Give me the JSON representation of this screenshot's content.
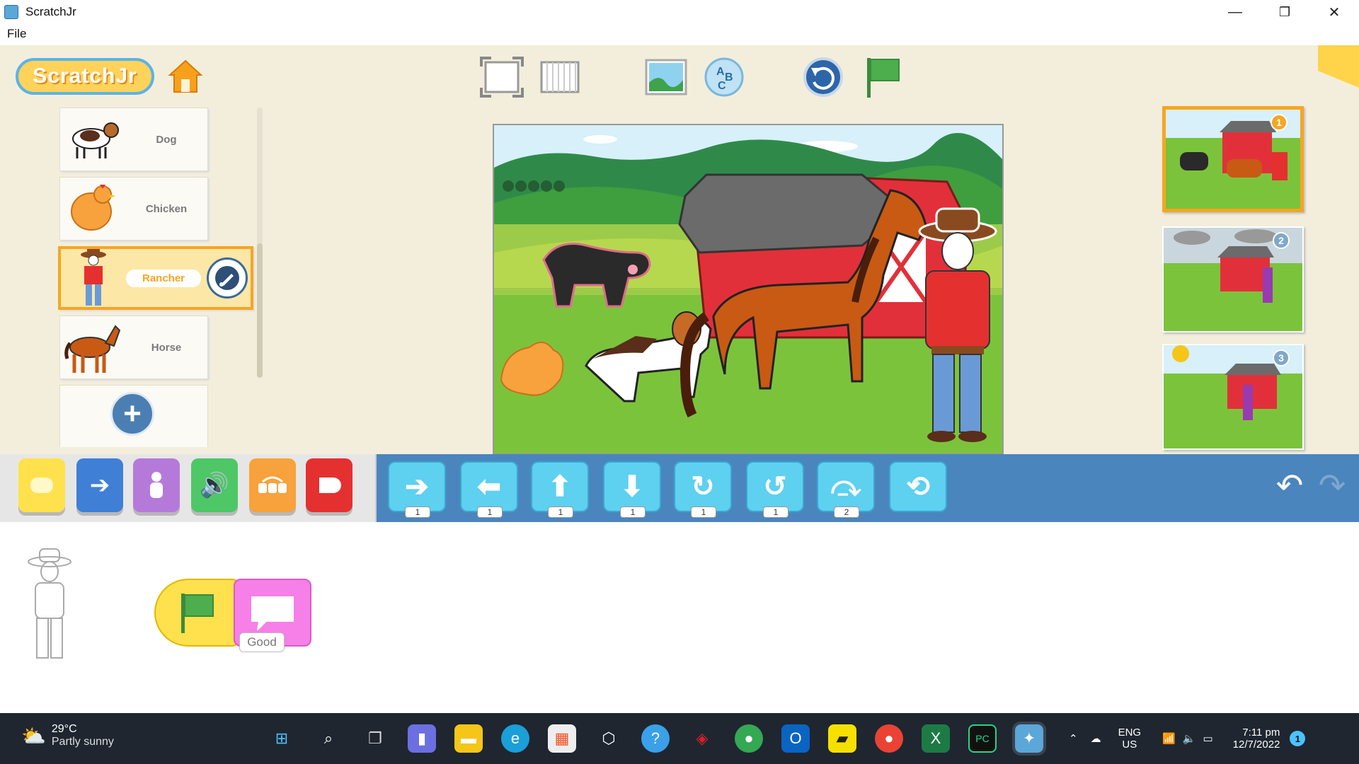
{
  "window": {
    "title": "ScratchJr",
    "minimize": "—",
    "maximize": "❐",
    "close": "✕"
  },
  "menu": {
    "file": "File"
  },
  "header": {
    "logo": "ScratchJr"
  },
  "sprites": [
    {
      "label": "Dog"
    },
    {
      "label": "Chicken"
    },
    {
      "label": "Rancher",
      "selected": true
    },
    {
      "label": "Horse"
    }
  ],
  "add_sprite": "+",
  "pages": [
    {
      "number": "1",
      "active": true
    },
    {
      "number": "2"
    },
    {
      "number": "3"
    }
  ],
  "categories": [
    {
      "name": "triggering",
      "color": "#ffe14d"
    },
    {
      "name": "motion",
      "color": "#3f7fd6"
    },
    {
      "name": "looks",
      "color": "#b57ad9"
    },
    {
      "name": "sound",
      "color": "#4ec766"
    },
    {
      "name": "control",
      "color": "#f7a23c"
    },
    {
      "name": "end",
      "color": "#e53030"
    }
  ],
  "motion_blocks": [
    {
      "icon": "move-right-icon",
      "num": "1"
    },
    {
      "icon": "move-left-icon",
      "num": "1"
    },
    {
      "icon": "move-up-icon",
      "num": "1"
    },
    {
      "icon": "move-down-icon",
      "num": "1"
    },
    {
      "icon": "turn-right-icon",
      "num": "1"
    },
    {
      "icon": "turn-left-icon",
      "num": "1"
    },
    {
      "icon": "hop-icon",
      "num": "2"
    },
    {
      "icon": "go-home-icon",
      "num": ""
    }
  ],
  "script": {
    "says_text": "Good"
  },
  "taskbar": {
    "temperature": "29°C",
    "weather": "Partly sunny",
    "lang1": "ENG",
    "lang2": "US",
    "time": "7:11 pm",
    "date": "12/7/2022",
    "notifications": "1"
  }
}
